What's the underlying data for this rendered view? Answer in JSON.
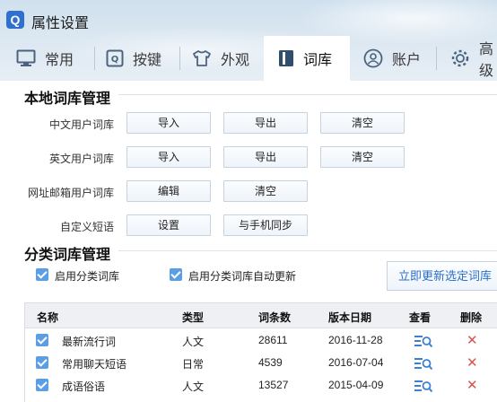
{
  "window": {
    "title": "属性设置",
    "logo_letter": "Q"
  },
  "tabs": [
    {
      "label": "常用",
      "icon": "monitor-icon"
    },
    {
      "label": "按键",
      "icon": "key-icon"
    },
    {
      "label": "外观",
      "icon": "shirt-icon"
    },
    {
      "label": "词库",
      "icon": "book-icon",
      "active": true
    },
    {
      "label": "账户",
      "icon": "user-icon"
    },
    {
      "label": "高级",
      "icon": "gear-icon"
    }
  ],
  "local": {
    "title": "本地词库管理",
    "rows": [
      {
        "label": "中文用户词库",
        "buttons": [
          "导入",
          "导出",
          "清空"
        ]
      },
      {
        "label": "英文用户词库",
        "buttons": [
          "导入",
          "导出",
          "清空"
        ]
      },
      {
        "label": "网址邮箱用户词库",
        "buttons": [
          "编辑",
          "清空"
        ]
      },
      {
        "label": "自定义短语",
        "buttons": [
          "设置",
          "与手机同步"
        ]
      }
    ]
  },
  "category": {
    "title": "分类词库管理",
    "enable_label": "启用分类词库",
    "auto_update_label": "启用分类词库自动更新",
    "update_button": "立即更新选定词库"
  },
  "table": {
    "headers": {
      "name": "名称",
      "type": "类型",
      "count": "词条数",
      "date": "版本日期",
      "view": "查看",
      "delete": "删除"
    },
    "rows": [
      {
        "name": "最新流行词",
        "type": "人文",
        "count": "28611",
        "date": "2016-11-28"
      },
      {
        "name": "常用聊天短语",
        "type": "日常",
        "count": "4539",
        "date": "2016-07-04"
      },
      {
        "name": "成语俗语",
        "type": "人文",
        "count": "13527",
        "date": "2015-04-09"
      }
    ]
  },
  "colors": {
    "accent": "#5b9ee6",
    "link": "#2a6fc9",
    "delete": "#d9534f",
    "logo": "#2f6fd0"
  }
}
